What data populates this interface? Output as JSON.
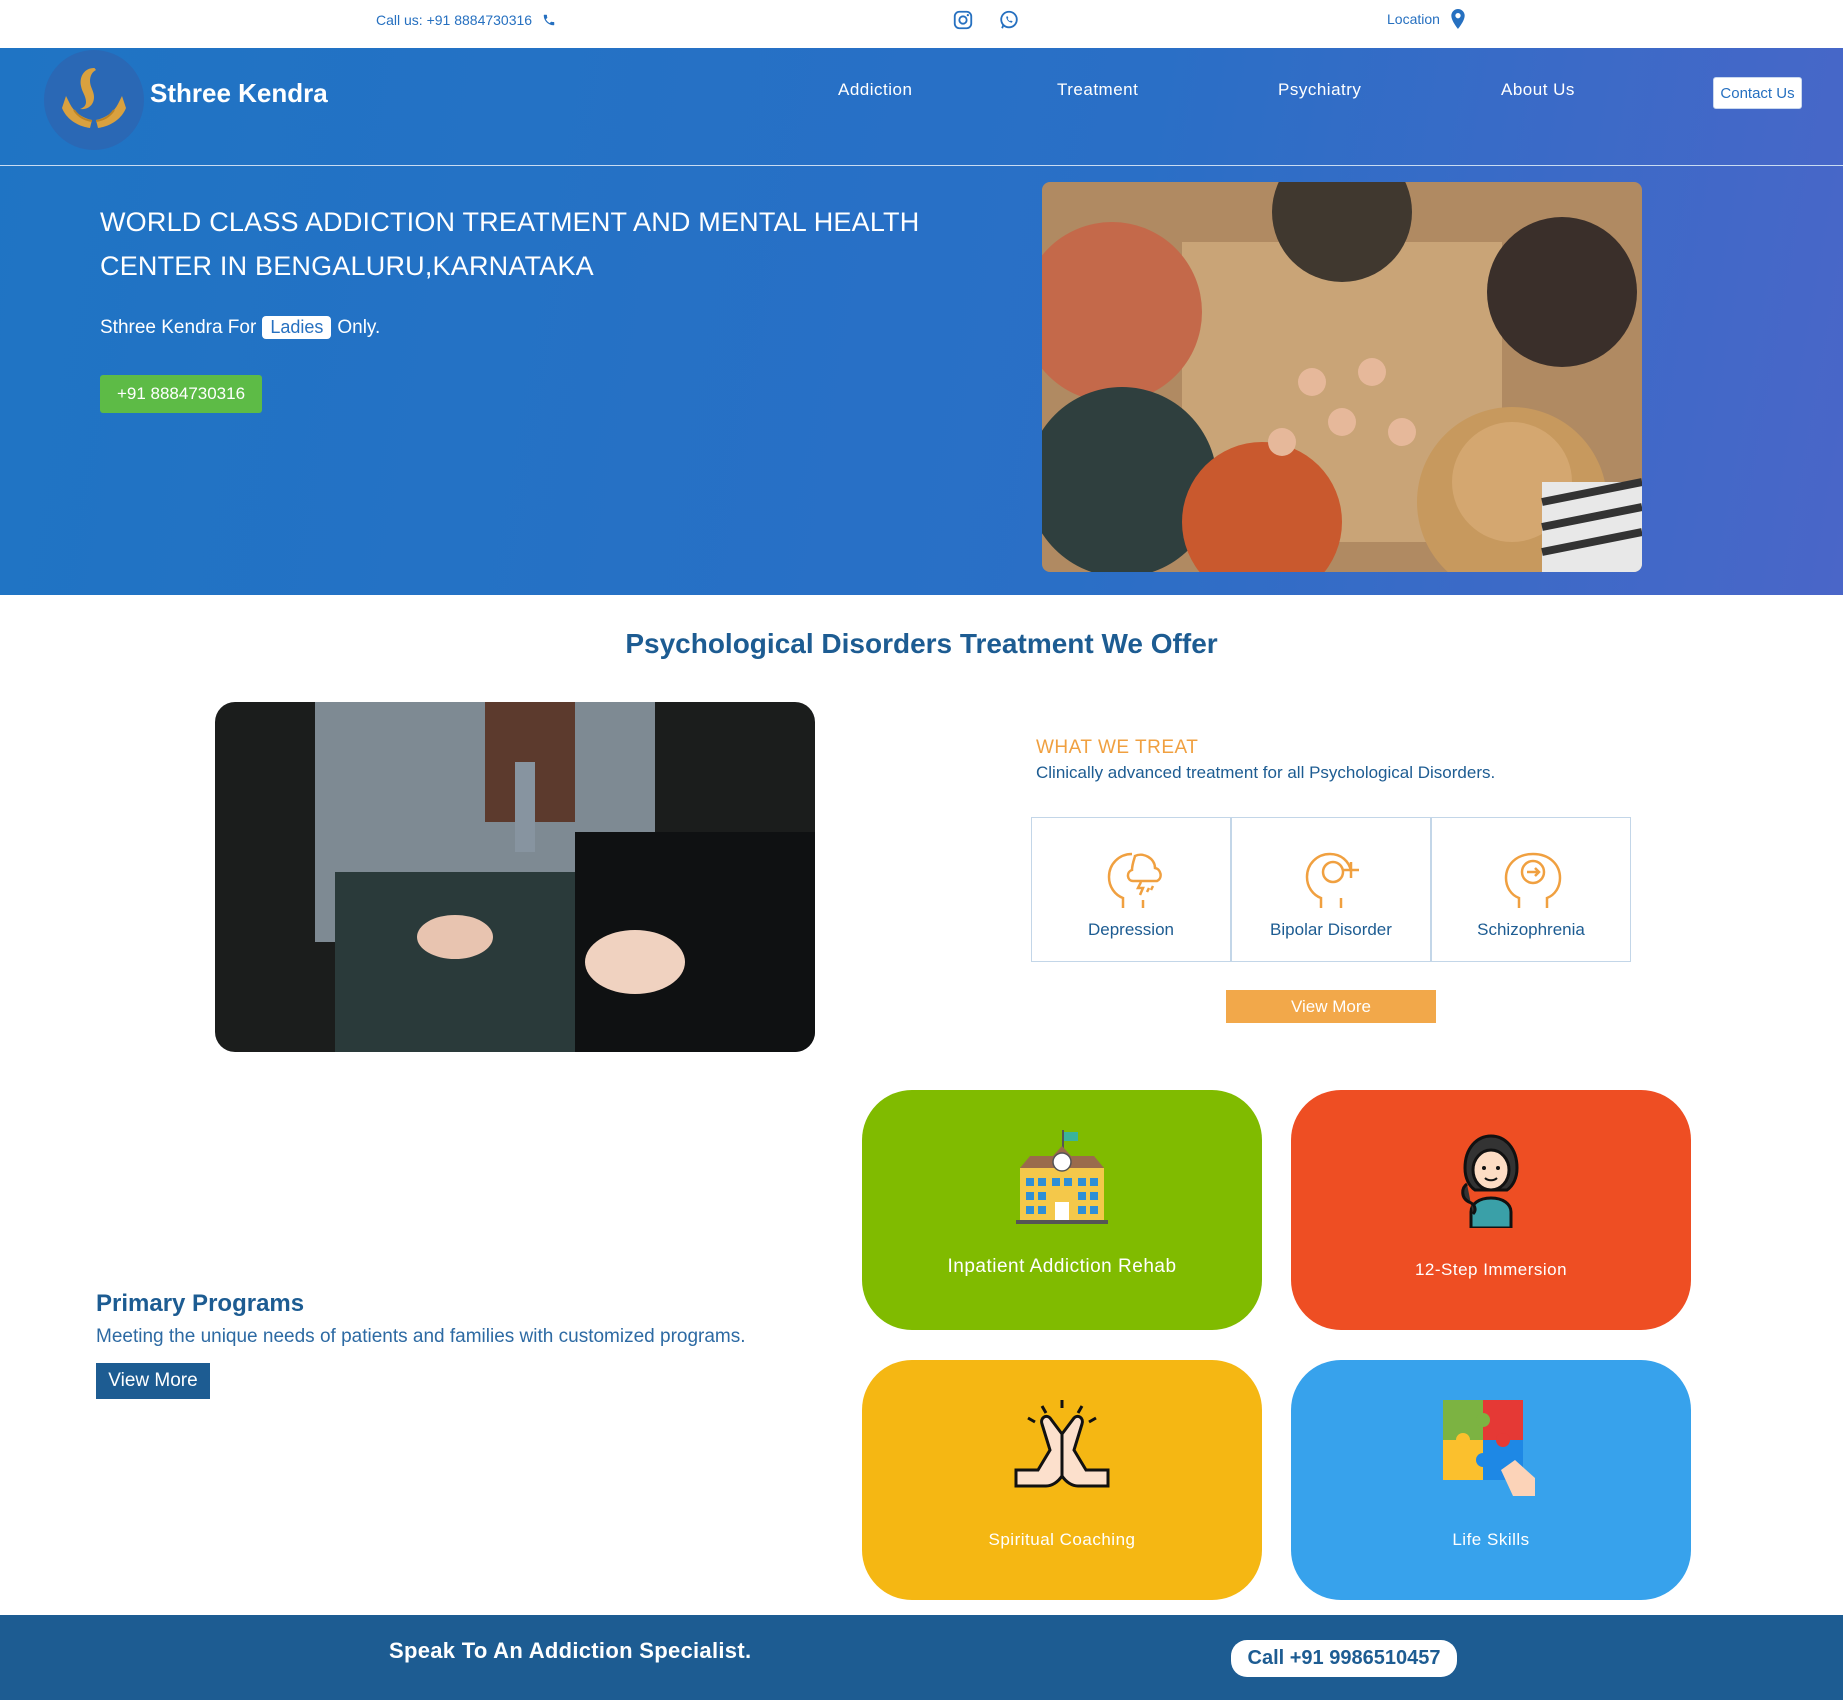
{
  "topbar": {
    "call_text": "Call us: +91 8884730316",
    "location_text": "Location",
    "icons": [
      "phone-icon",
      "instagram-icon",
      "whatsapp-icon",
      "map-pin-icon"
    ]
  },
  "header": {
    "brand": "Sthree Kendra",
    "nav": [
      "Addiction",
      "Treatment",
      "Psychiatry",
      "About Us"
    ],
    "contact_label": "Contact Us"
  },
  "hero": {
    "title": "WORLD CLASS ADDICTION TREATMENT AND MENTAL HEALTH CENTER IN BENGALURU,KARNATAKA",
    "sub_prefix": "Sthree Kendra For",
    "sub_pill": "Ladies",
    "sub_suffix": "Only.",
    "call_button": "+91 8884730316"
  },
  "psych": {
    "title": "Psychological Disorders Treatment We Offer",
    "label": "WHAT WE TREAT",
    "subtitle": "Clinically advanced treatment for all Psychological Disorders.",
    "items": [
      "Depression",
      "Bipolar Disorder",
      "Schizophrenia"
    ],
    "view_more": "View More"
  },
  "programs": {
    "title": "Primary Programs",
    "description": "Meeting the unique needs of patients and families with customized programs.",
    "view_more": "View More",
    "cards": [
      {
        "label": "Inpatient Addiction Rehab",
        "color": "#80bb00",
        "icon": "school-building-icon"
      },
      {
        "label": "12-Step Immersion",
        "color": "#ee4e23",
        "icon": "woman-avatar-icon"
      },
      {
        "label": "Spiritual Coaching",
        "color": "#f5b713",
        "icon": "praying-hands-icon"
      },
      {
        "label": "Life Skills",
        "color": "#37a2ec",
        "icon": "puzzle-hand-icon"
      }
    ]
  },
  "footer": {
    "text": "Speak To An Addiction Specialist.",
    "call": "Call +91 9986510457"
  },
  "colors": {
    "brand_blue": "#1f74c4",
    "dark_blue": "#1d5c92",
    "accent_orange": "#f2a84a",
    "green_button": "#5dbb46"
  }
}
